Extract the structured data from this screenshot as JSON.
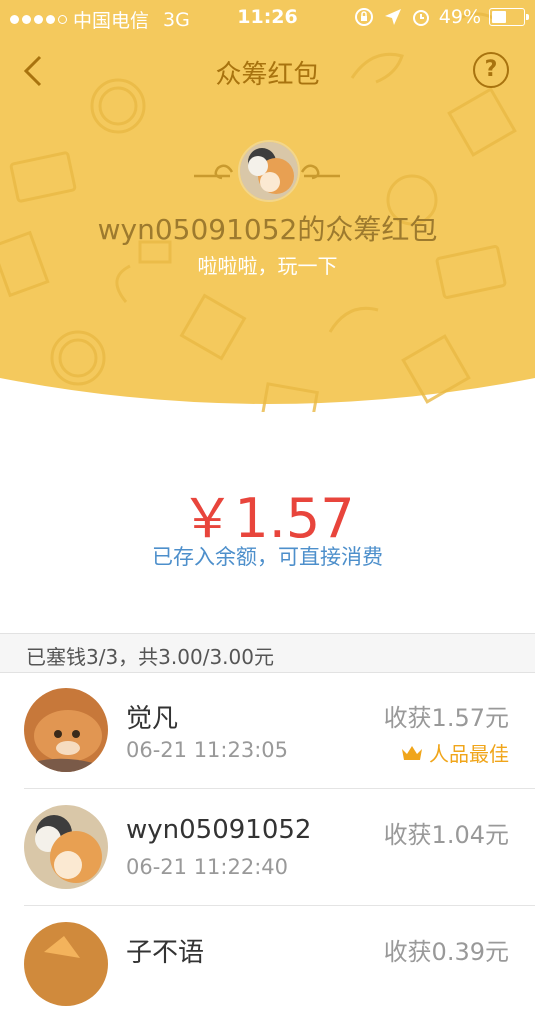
{
  "status_bar": {
    "carrier": "中国电信",
    "network": "3G",
    "time": "11:26",
    "battery": "49%",
    "battery_level": 0.49
  },
  "nav": {
    "title": "众筹红包",
    "help_label": "?"
  },
  "envelope": {
    "owner_title": "wyn05091052的众筹红包",
    "wish": "啦啦啦，玩一下"
  },
  "result": {
    "amount": "￥1.57",
    "note": "已存入余额，可直接消费"
  },
  "summary": "已塞钱3/3，共3.00/3.00元",
  "contributors": [
    {
      "name": "觉凡",
      "time": "06-21 11:23:05",
      "got": "收获1.57元",
      "badge": "人品最佳"
    },
    {
      "name": "wyn05091052",
      "time": "06-21 11:22:40",
      "got": "收获1.04元",
      "badge": ""
    },
    {
      "name": "子不语",
      "time": "",
      "got": "收获0.39元",
      "badge": ""
    }
  ],
  "colors": {
    "header_bg": "#f4c95d",
    "amount": "#e8453c",
    "note": "#4d8fcb",
    "badge": "#f0a51a"
  }
}
